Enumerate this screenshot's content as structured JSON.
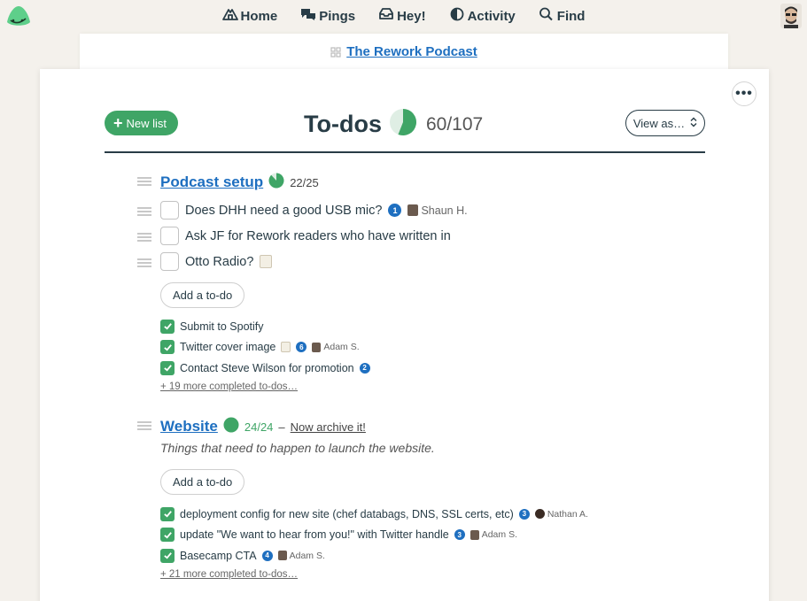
{
  "nav": {
    "items": [
      {
        "label": "Home",
        "icon": "home-icon"
      },
      {
        "label": "Pings",
        "icon": "pings-icon"
      },
      {
        "label": "Hey!",
        "icon": "hey-icon"
      },
      {
        "label": "Activity",
        "icon": "activity-icon"
      },
      {
        "label": "Find",
        "icon": "search-icon"
      }
    ]
  },
  "project": {
    "name": "The Rework Podcast"
  },
  "page": {
    "title": "To-dos",
    "count": "60/107",
    "progress": 0.56,
    "new_list_label": "New list",
    "view_as_label": "View as…"
  },
  "lists": [
    {
      "name": "Podcast setup",
      "ratio": "22/25",
      "progress": 0.88,
      "todos": [
        {
          "text": "Does DHH need a good USB mic?",
          "comments": "1",
          "assignee": "Shaun H."
        },
        {
          "text": "Ask JF for Rework readers who have written in"
        },
        {
          "text": "Otto Radio?",
          "has_note": true
        }
      ],
      "add_label": "Add a to-do",
      "completed": [
        {
          "text": "Submit to Spotify"
        },
        {
          "text": "Twitter cover image",
          "has_note": true,
          "comments": "6",
          "assignee": "Adam S."
        },
        {
          "text": "Contact Steve Wilson for promotion",
          "comments": "2"
        }
      ],
      "more_completed": "+ 19 more completed to-dos…"
    },
    {
      "name": "Website",
      "ratio": "24/24",
      "progress": 1.0,
      "archive_label": "Now archive it!",
      "description": "Things that need to happen to launch the website.",
      "add_label": "Add a to-do",
      "completed": [
        {
          "text": "deployment config for new site (chef databags, DNS, SSL certs, etc)",
          "comments": "3",
          "assignee": "Nathan A."
        },
        {
          "text": "update \"We want to hear from you!\" with Twitter handle",
          "comments": "3",
          "assignee": "Adam S."
        },
        {
          "text": "Basecamp CTA",
          "comments": "4",
          "assignee": "Adam S."
        }
      ],
      "more_completed": "+ 21 more completed to-dos…"
    }
  ],
  "colors": {
    "accent": "#3fa566",
    "link": "#1e6fc0",
    "ink": "#283c46"
  }
}
